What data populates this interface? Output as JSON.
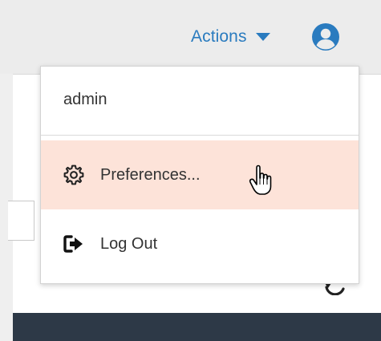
{
  "header": {
    "actions_label": "Actions",
    "caret_icon": "caret-down-icon",
    "avatar_icon": "user-circle-icon"
  },
  "user_menu": {
    "username": "admin",
    "items": [
      {
        "label": "Preferences...",
        "icon": "gear-icon",
        "state": "hover"
      },
      {
        "label": "Log Out",
        "icon": "sign-out-icon"
      }
    ]
  },
  "page": {
    "refresh_icon": "refresh-icon"
  },
  "colors": {
    "accent": "#2a7bbf",
    "hover_bg": "#fde3d9",
    "topbar_bg": "#ececec",
    "footer_bg": "#2d3947",
    "text": "#333333"
  }
}
